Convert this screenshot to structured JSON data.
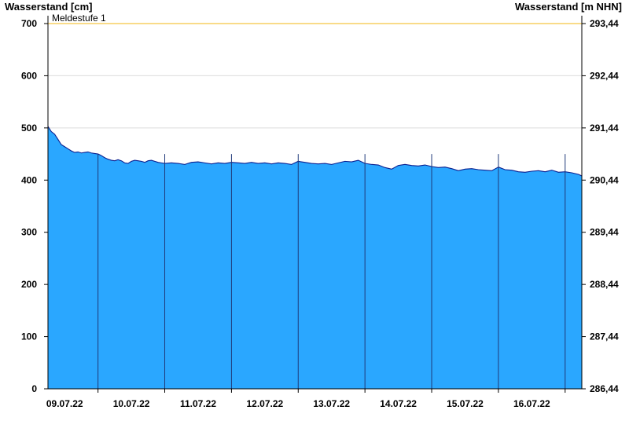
{
  "chart_data": {
    "type": "area",
    "left_axis_title": "Wasserstand [cm]",
    "right_axis_title": "Wasserstand [m NHN]",
    "ylim": [
      0,
      700
    ],
    "y_ticks": [
      0,
      100,
      200,
      300,
      400,
      500,
      600,
      700
    ],
    "right_ticks": [
      "286,44",
      "287,44",
      "288,44",
      "289,44",
      "290,44",
      "291,44",
      "292,44",
      "293,44"
    ],
    "right_axis_offset_m": 286.44,
    "x_range_days": [
      8.25,
      16.25
    ],
    "day_boundaries": [
      9.0,
      10.0,
      11.0,
      12.0,
      13.0,
      14.0,
      15.0,
      16.0
    ],
    "x_tick_labels": [
      "09.07.22",
      "10.07.22",
      "11.07.22",
      "12.07.22",
      "13.07.22",
      "14.07.22",
      "15.07.22",
      "16.07.22"
    ],
    "reference_lines": [
      {
        "label": "Meldestufe 1",
        "value": 700,
        "color": "#f5c542"
      }
    ],
    "series": [
      {
        "x": [
          8.25,
          8.3,
          8.35,
          8.4,
          8.45,
          8.5,
          8.55,
          8.6,
          8.65,
          8.7,
          8.75,
          8.8,
          8.85,
          8.9,
          8.95,
          9.0,
          9.05,
          9.1,
          9.15,
          9.2,
          9.25,
          9.3,
          9.35,
          9.4,
          9.45,
          9.5,
          9.55,
          9.6,
          9.65,
          9.7,
          9.75,
          9.8,
          9.85,
          9.9,
          9.95,
          10.0,
          10.1,
          10.2,
          10.3,
          10.4,
          10.5,
          10.6,
          10.7,
          10.8,
          10.9,
          11.0,
          11.1,
          11.2,
          11.3,
          11.4,
          11.5,
          11.6,
          11.7,
          11.8,
          11.9,
          12.0,
          12.1,
          12.2,
          12.3,
          12.4,
          12.5,
          12.6,
          12.7,
          12.8,
          12.9,
          13.0,
          13.1,
          13.2,
          13.3,
          13.4,
          13.5,
          13.6,
          13.7,
          13.8,
          13.9,
          14.0,
          14.1,
          14.2,
          14.3,
          14.4,
          14.5,
          14.6,
          14.7,
          14.8,
          14.9,
          15.0,
          15.1,
          15.2,
          15.3,
          15.4,
          15.5,
          15.6,
          15.7,
          15.8,
          15.9,
          16.0,
          16.1,
          16.2,
          16.25
        ],
        "values": [
          503,
          493,
          488,
          478,
          468,
          464,
          460,
          456,
          453,
          454,
          452,
          453,
          454,
          452,
          451,
          450,
          447,
          443,
          440,
          438,
          437,
          439,
          437,
          433,
          432,
          436,
          438,
          437,
          436,
          434,
          437,
          438,
          436,
          434,
          433,
          432,
          433,
          432,
          430,
          434,
          435,
          433,
          431,
          433,
          432,
          434,
          433,
          432,
          434,
          432,
          433,
          431,
          433,
          432,
          430,
          436,
          434,
          432,
          431,
          432,
          430,
          433,
          436,
          435,
          438,
          432,
          430,
          429,
          424,
          421,
          428,
          430,
          428,
          427,
          429,
          426,
          424,
          425,
          422,
          418,
          421,
          422,
          420,
          419,
          418,
          425,
          420,
          419,
          416,
          415,
          417,
          418,
          416,
          419,
          415,
          416,
          414,
          411,
          408
        ],
        "fill": "#2aa7ff",
        "line": "#0a1f8f"
      }
    ],
    "grid": true
  }
}
